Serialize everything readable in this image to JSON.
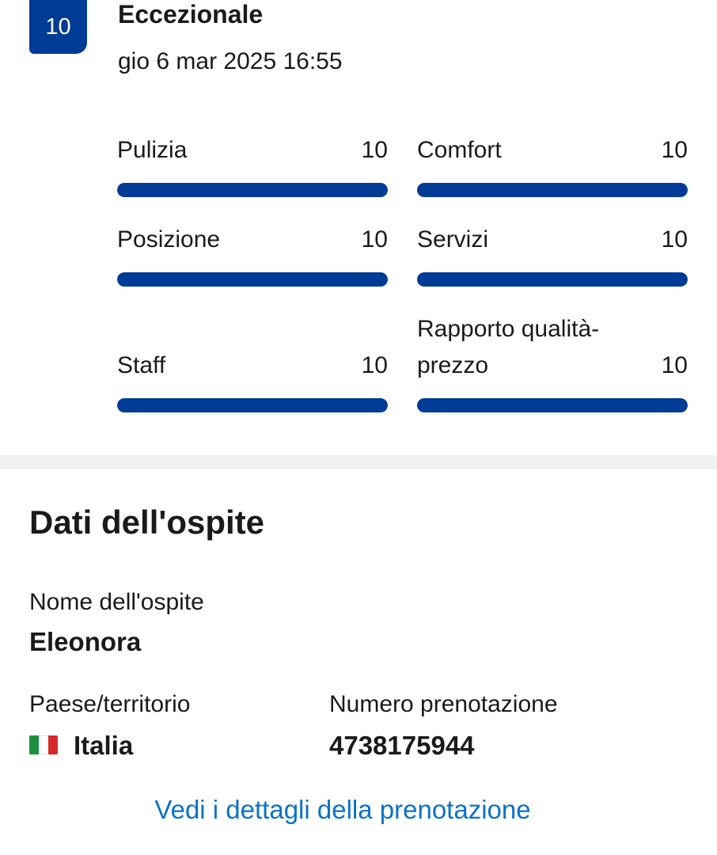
{
  "review": {
    "score": "10",
    "rating_label": "Eccezionale",
    "date": "gio 6 mar 2025 16:55"
  },
  "categories": [
    {
      "name": "Pulizia",
      "score": "10",
      "fill": 1.0
    },
    {
      "name": "Comfort",
      "score": "10",
      "fill": 1.0
    },
    {
      "name": "Posizione",
      "score": "10",
      "fill": 1.0
    },
    {
      "name": "Servizi",
      "score": "10",
      "fill": 1.0
    },
    {
      "name": "Staff",
      "score": "10",
      "fill": 1.0
    },
    {
      "name": "Rapporto qualità-prezzo",
      "name_line1": "Rapporto qualità-",
      "name_line2": "prezzo",
      "score": "10",
      "fill": 1.0
    }
  ],
  "guest": {
    "section_title": "Dati dell'ospite",
    "name_label": "Nome dell'ospite",
    "name_value": "Eleonora",
    "country_label": "Paese/territorio",
    "country_value": "Italia",
    "booking_label": "Numero prenotazione",
    "booking_value": "4738175944",
    "details_link": "Vedi i dettagli della prenotazione"
  },
  "colors": {
    "accent": "#003b95",
    "link": "#0a72c8",
    "divider": "#f0f0f0"
  },
  "icons": {
    "flag": "italy-flag-icon"
  }
}
